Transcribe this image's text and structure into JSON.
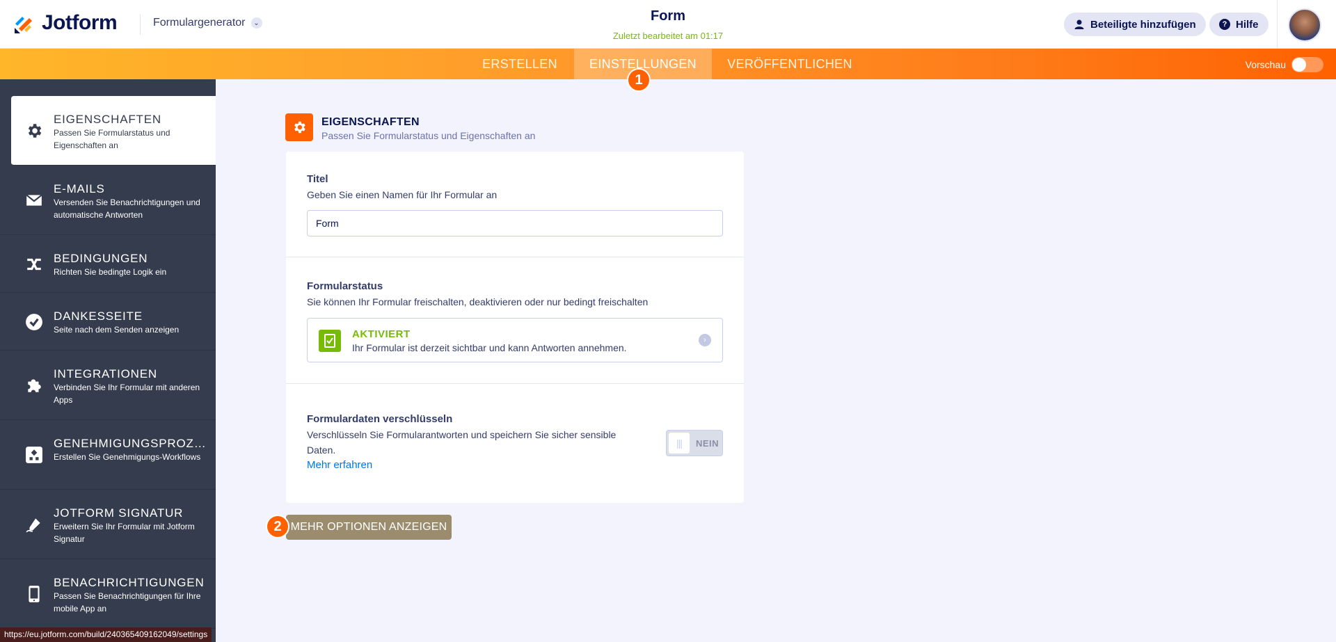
{
  "header": {
    "logo_text": "Jotform",
    "builder_label": "Formulargenerator",
    "form_title": "Form",
    "last_edited": "Zuletzt bearbeitet am 01:17",
    "collaborators_label": "Beteiligte hinzufügen",
    "help_label": "Hilfe"
  },
  "nav": {
    "tabs": [
      {
        "label": "ERSTELLEN"
      },
      {
        "label": "EINSTELLUNGEN",
        "active": true
      },
      {
        "label": "VERÖFFENTLICHEN"
      }
    ],
    "preview_label": "Vorschau",
    "preview_on": false
  },
  "badges": {
    "step1": "1",
    "step2": "2"
  },
  "sidebar": {
    "items": [
      {
        "title": "EIGENSCHAFTEN",
        "desc": "Passen Sie Formularstatus und Eigenschaften an",
        "icon": "gear-icon",
        "active": true
      },
      {
        "title": "E-MAILS",
        "desc": "Versenden Sie Benachrichtigungen und automatische Antworten",
        "icon": "mail-icon"
      },
      {
        "title": "BEDINGUNGEN",
        "desc": "Richten Sie bedingte Logik ein",
        "icon": "shuffle-icon"
      },
      {
        "title": "DANKESSEITE",
        "desc": "Seite nach dem Senden anzeigen",
        "icon": "check-circle-icon"
      },
      {
        "title": "INTEGRATIONEN",
        "desc": "Verbinden Sie Ihr Formular mit anderen Apps",
        "icon": "puzzle-icon"
      },
      {
        "title": "GENEHMIGUNGSPROZESSE",
        "desc": "Erstellen Sie Genehmigungs-Workflows",
        "icon": "workflow-icon"
      },
      {
        "title": "JOTFORM SIGNATUR",
        "desc": "Erweitern Sie Ihr Formular mit Jotform Signatur",
        "icon": "signature-icon"
      },
      {
        "title": "BENACHRICHTIGUNGEN",
        "desc": "Passen Sie Benachrichtigungen für Ihre mobile App an",
        "icon": "mobile-icon"
      }
    ]
  },
  "status_url": "https://eu.jotform.com/build/240365409162049/settings",
  "section": {
    "title": "EIGENSCHAFTEN",
    "desc": "Passen Sie Formularstatus und Eigenschaften an"
  },
  "fields": {
    "title_label": "Titel",
    "title_hint": "Geben Sie einen Namen für Ihr Formular an",
    "title_value": "Form",
    "status_label": "Formularstatus",
    "status_hint": "Sie können Ihr Formular freischalten, deaktivieren oder nur bedingt freischalten",
    "status_value": "AKTIVIERT",
    "status_desc": "Ihr Formular ist derzeit sichtbar und kann Antworten annehmen.",
    "encrypt_label": "Formulardaten verschlüsseln",
    "encrypt_hint": "Verschlüsseln Sie Formularantworten und speichern Sie sicher sensible Daten.",
    "encrypt_link": "Mehr erfahren",
    "encrypt_toggle": "NEIN"
  },
  "more_options_label": "MEHR OPTIONEN ANZEIGEN",
  "colors": {
    "accent": "#ff6100",
    "sidebar_bg": "#343c4d",
    "success": "#78bb07",
    "link": "#0075e3"
  }
}
